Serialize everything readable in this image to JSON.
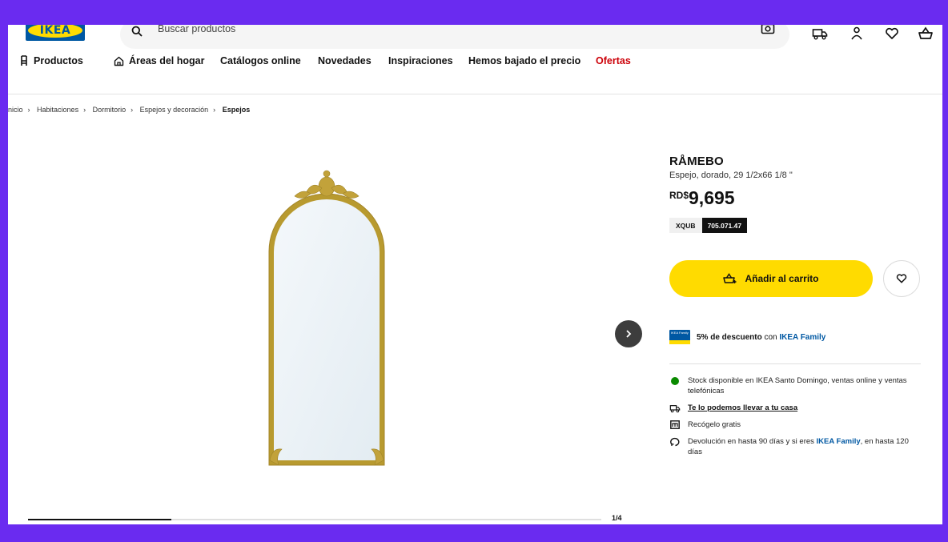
{
  "header": {
    "logo_text": "IKEA",
    "search_placeholder": "Buscar productos",
    "icons": [
      "search-icon",
      "camera-icon",
      "delivery-truck-icon",
      "user-icon",
      "heart-icon",
      "shopping-bag-icon"
    ]
  },
  "nav": {
    "items": [
      {
        "label": "Productos"
      },
      {
        "label": "Áreas del hogar"
      },
      {
        "label": "Catálogos online"
      },
      {
        "label": "Novedades"
      },
      {
        "label": "Inspiraciones"
      },
      {
        "label": "Hemos bajado el precio"
      },
      {
        "label": "Ofertas"
      }
    ]
  },
  "breadcrumb": [
    "nicio",
    "Habitaciones",
    "Dormitorio",
    "Espejos y decoración",
    "Espejos"
  ],
  "gallery": {
    "pager": "1/4",
    "progress_fraction": 0.25
  },
  "product": {
    "name": "RÅMEBO",
    "description": "Espejo, dorado, 29 1/2x66 1/8 \"",
    "currency": "RD$",
    "price": "9,695",
    "article_code": "XQUB",
    "article_number": "705.071.47",
    "add_to_cart": "Añadir al carrito",
    "family_discount": "5% de descuento",
    "family_con": "con",
    "family_name": "IKEA Family",
    "family_card_text": "IKEA Family"
  },
  "availability": {
    "stock": "Stock disponible en IKEA Santo Domingo, ventas online y ventas telefónicas",
    "delivery": "Te lo podemos llevar a tu casa",
    "pickup": "Recógelo gratis",
    "returns_before": "Devolución en hasta 90 días y si eres",
    "returns_family": "IKEA Family",
    "returns_after": ", en hasta 120 días"
  },
  "colors": {
    "ikea_blue": "#0058a3",
    "ikea_yellow": "#ffdb00",
    "offer_red": "#cc0008",
    "stock_green": "#0a8a00",
    "frame_purple": "#6a2bf0"
  }
}
